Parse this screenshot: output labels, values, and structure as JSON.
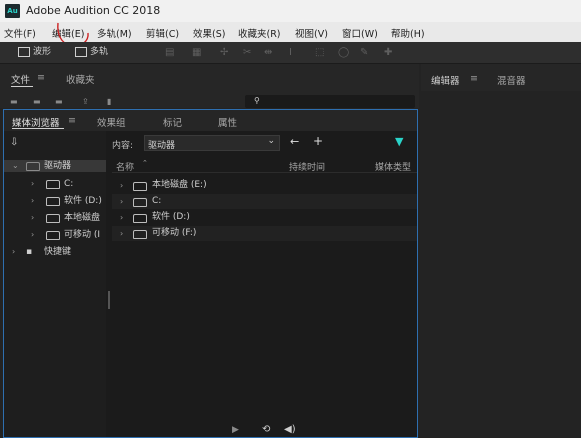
{
  "title": "Adobe Audition CC 2018",
  "app_icon": "Au",
  "menu": [
    "文件(F)",
    "编辑(E)",
    "多轨(M)",
    "剪辑(C)",
    "效果(S)",
    "收藏夹(R)",
    "视图(V)",
    "窗口(W)",
    "帮助(H)"
  ],
  "toolbar": {
    "waveform": "波形",
    "multitrack": "多轨"
  },
  "files_panel": {
    "tab_files": "文件",
    "tab_favorites": "收藏夹"
  },
  "media_browser": {
    "tabs": [
      "媒体浏览器",
      "效果组",
      "标记",
      "属性"
    ],
    "content_label": "内容:",
    "content_value": "驱动器",
    "tree": {
      "root": "驱动器",
      "items": [
        "C:",
        "软件 (D:)",
        "本地磁盘",
        "可移动 (I"
      ],
      "shortcuts": "快捷键"
    },
    "columns": [
      "名称",
      "持续时间",
      "媒体类型"
    ],
    "rows": [
      "本地磁盘 (E:)",
      "C:",
      "软件 (D:)",
      "可移动 (F:)"
    ]
  },
  "right_panel": {
    "tab_editor": "编辑器",
    "tab_mixer": "混音器"
  },
  "colors": {
    "accent": "#2e6fb0",
    "annotation": "#cc2222",
    "app_icon_text": "#2ad3c9"
  }
}
